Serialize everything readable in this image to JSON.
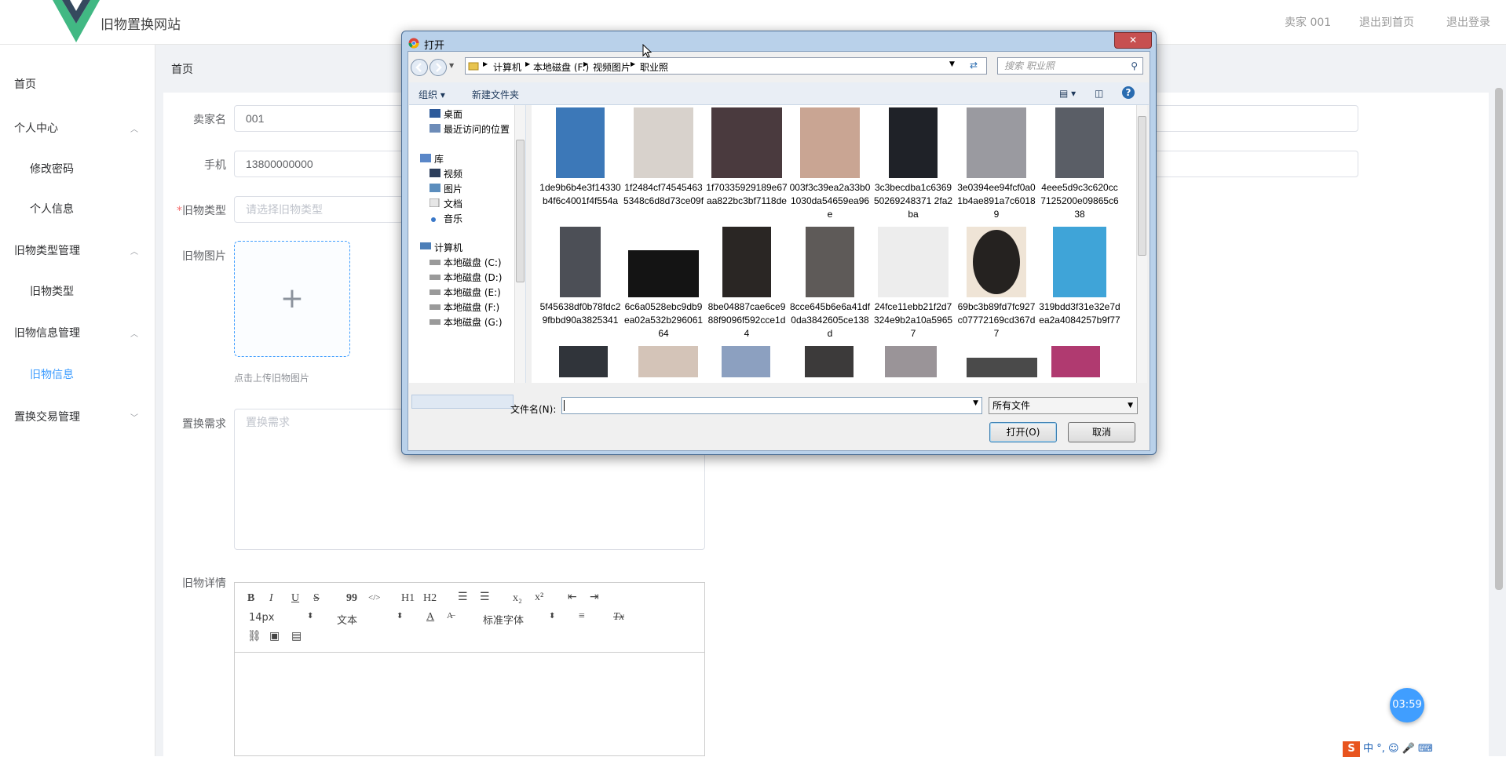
{
  "site": {
    "title": "旧物置换网站"
  },
  "topnav": {
    "user": "卖家 001",
    "back_home": "退出到首页",
    "logout": "退出登录"
  },
  "sidebar": {
    "home": "首页",
    "groups": [
      {
        "label": "个人中心",
        "items": [
          "修改密码",
          "个人信息"
        ]
      },
      {
        "label": "旧物类型管理",
        "items": [
          "旧物类型"
        ]
      },
      {
        "label": "旧物信息管理",
        "items": [
          "旧物信息"
        ]
      },
      {
        "label": "置换交易管理",
        "items": []
      }
    ]
  },
  "breadcrumb": "首页",
  "form": {
    "seller_label": "卖家名",
    "seller_value": "001",
    "phone_label": "手机",
    "phone_value": "13800000000",
    "type_label": "旧物类型",
    "type_placeholder": "请选择旧物类型",
    "image_label": "旧物图片",
    "image_hint": "点击上传旧物图片",
    "demand_label": "置换需求",
    "demand_placeholder": "置换需求",
    "detail_label": "旧物详情"
  },
  "editor": {
    "font_size": "14px",
    "block_type": "文本",
    "font_family": "标准字体",
    "tools": [
      "B",
      "I",
      "U",
      "S",
      "99",
      "</>",
      "H1",
      "H2",
      "ol",
      "ul",
      "x2",
      "x²",
      "outdent",
      "indent"
    ]
  },
  "clock": "03:59",
  "ime": "中 °, ☺ 🎤 ⌨",
  "dialog": {
    "title": "打开",
    "close": "✕",
    "path": [
      "计算机",
      "本地磁盘 (F:)",
      "视频图片",
      "职业照"
    ],
    "search_placeholder": "搜索 职业照",
    "organize": "组织 ▾",
    "new_folder": "新建文件夹",
    "nav": [
      {
        "label": "桌面"
      },
      {
        "label": "最近访问的位置"
      },
      {
        "label": "库"
      },
      {
        "label": "视频"
      },
      {
        "label": "图片"
      },
      {
        "label": "文档"
      },
      {
        "label": "音乐"
      },
      {
        "label": "计算机"
      },
      {
        "label": "本地磁盘 (C:)"
      },
      {
        "label": "本地磁盘 (D:)"
      },
      {
        "label": "本地磁盘 (E:)"
      },
      {
        "label": "本地磁盘 (F:)"
      },
      {
        "label": "本地磁盘 (G:)"
      }
    ],
    "files": [
      "1de9b6b4e3f14330b4f6c4001f4f554a",
      "1f2484cf745454635348c6d8d73ce09f",
      "1f70335929189e67aa822bc3bf7118de",
      "003f3c39ea2a33b01030da54659ea96e",
      "3c3becdba1c636950269248371 2fa2ba",
      "3e0394ee94fcf0a01b4ae891a7c60189",
      "4eee5d9c3c620cc7125200e09865c638",
      "5f45638df0b78fdc29fbbd90a3825341",
      "6c6a0528ebc9db9ea02a532b29606164",
      "8be04887cae6ce988f9096f592cce1d4",
      "8cce645b6e6a41df0da3842605ce138d",
      "24fce11ebb21f2d7324e9b2a10a59657",
      "69bc3b89fd7fc927c07772169cd367d7",
      "319bdd3f31e32e7dea2a4084257b9f77"
    ],
    "filename_label": "文件名(N):",
    "filename_value": "",
    "filetype": "所有文件",
    "open_button": "打开(O)",
    "cancel_button": "取消"
  },
  "colors": {
    "accent": "#409eff",
    "required": "#f56c6c",
    "dialog_frame": "#b9d1ea",
    "close_red": "#c75050"
  }
}
